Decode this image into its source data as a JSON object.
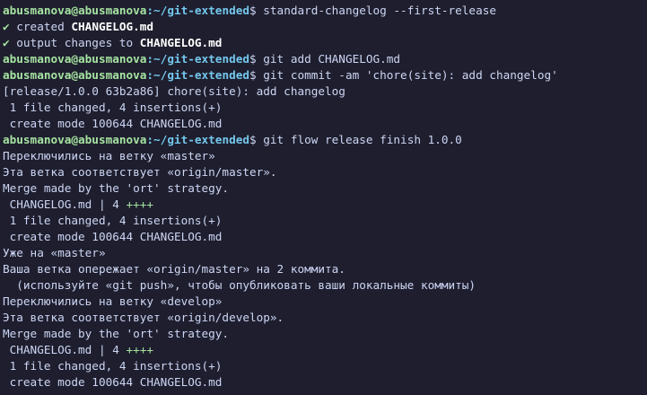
{
  "terminal": {
    "user_host": "abusmanova@abusmanova",
    "path": ":~/git-extended",
    "dollar": "$",
    "cmd1": "standard-changelog --first-release",
    "check_mark": "✔",
    "created_label": "created",
    "created_file": "CHANGELOG.md",
    "output_label": "output changes to",
    "output_file": "CHANGELOG.md",
    "cmd2": "git add CHANGELOG.md",
    "cmd3": "git commit -am 'chore(site): add changelog'",
    "commit_result": "[release/1.0.0 63b2a86] chore(site): add changelog",
    "files_changed_1": " 1 file changed, 4 insertions(+)",
    "create_mode_1": " create mode 100644 CHANGELOG.md",
    "cmd4": "git flow release finish 1.0.0",
    "switched_master": "Переключились на ветку «master»",
    "branch_matches_master": "Эта ветка соответствует «origin/master».",
    "merge_ort_1": "Merge made by the 'ort' strategy.",
    "stat_file_1": " CHANGELOG.md | 4 ",
    "stat_plus_1": "++++",
    "files_changed_2": " 1 file changed, 4 insertions(+)",
    "create_mode_2": " create mode 100644 CHANGELOG.md",
    "already_master": "Уже на «master»",
    "ahead_msg": "Ваша ветка опережает «origin/master» на 2 коммита.",
    "push_hint": "  (используйте «git push», чтобы опубликовать ваши локальные коммиты)",
    "switched_develop": "Переключились на ветку «develop»",
    "branch_matches_develop": "Эта ветка соответствует «origin/develop».",
    "merge_ort_2": "Merge made by the 'ort' strategy.",
    "stat_file_2": " CHANGELOG.md | 4 ",
    "stat_plus_2": "++++",
    "files_changed_3": " 1 file changed, 4 insertions(+)",
    "create_mode_3": " create mode 100644 CHANGELOG.md"
  },
  "colors": {
    "background": "#1e1e2e",
    "prompt_user": "#a6e3a1",
    "prompt_path": "#74c7ec",
    "text": "#cdd6f4",
    "plus": "#a6e3a1"
  }
}
